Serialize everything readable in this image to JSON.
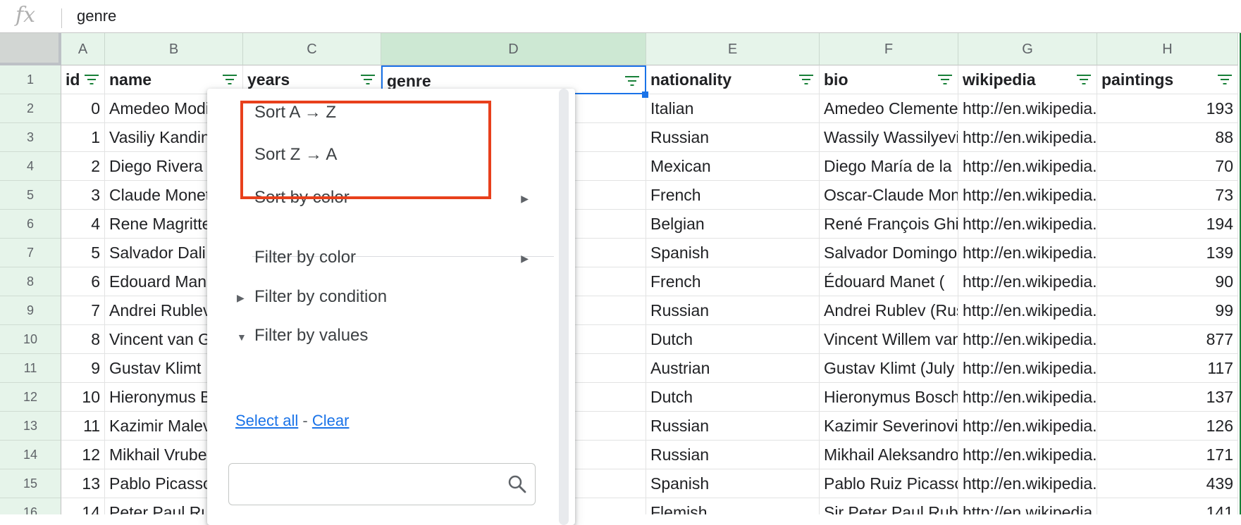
{
  "formula_bar": {
    "fx_label": "fx",
    "value": "genre"
  },
  "columns": [
    "A",
    "B",
    "C",
    "D",
    "E",
    "F",
    "G",
    "H"
  ],
  "header_row": [
    "id",
    "name",
    "years",
    "genre",
    "nationality",
    "bio",
    "wikipedia",
    "paintings"
  ],
  "rows": [
    {
      "n": "2",
      "id": "0",
      "name": "Amedeo Modigliani",
      "nationality": "Italian",
      "bio": "Amedeo Clemente Modigliani",
      "wikipedia": "http://en.wikipedia.org",
      "paintings": "193"
    },
    {
      "n": "3",
      "id": "1",
      "name": "Vasiliy Kandinskiy",
      "nationality": "Russian",
      "bio": "Wassily Wassilyevich",
      "wikipedia": "http://en.wikipedia.org",
      "paintings": "88"
    },
    {
      "n": "4",
      "id": "2",
      "name": "Diego Rivera",
      "nationality": "Mexican",
      "bio": "Diego María de la",
      "wikipedia": "http://en.wikipedia.org",
      "paintings": "70"
    },
    {
      "n": "5",
      "id": "3",
      "name": "Claude Monet",
      "nationality": "French",
      "bio": "Oscar-Claude Monet",
      "wikipedia": "http://en.wikipedia.org",
      "paintings": "73"
    },
    {
      "n": "6",
      "id": "4",
      "name": "Rene Magritte",
      "nationality": "Belgian",
      "bio": "René François Ghislain",
      "wikipedia": "http://en.wikipedia.org",
      "paintings": "194"
    },
    {
      "n": "7",
      "id": "5",
      "name": "Salvador Dali",
      "nationality": "Spanish",
      "bio": "Salvador Domingo",
      "wikipedia": "http://en.wikipedia.org",
      "paintings": "139"
    },
    {
      "n": "8",
      "id": "6",
      "name": "Edouard Manet",
      "nationality": "French",
      "bio": "Édouard Manet (",
      "wikipedia": "http://en.wikipedia.org",
      "paintings": "90"
    },
    {
      "n": "9",
      "id": "7",
      "name": "Andrei Rublev",
      "nationality": "Russian",
      "bio": "Andrei Rublev (Russian",
      "wikipedia": "http://en.wikipedia.org",
      "paintings": "99"
    },
    {
      "n": "10",
      "id": "8",
      "name": "Vincent van Gogh",
      "nationality": "Dutch",
      "bio": "Vincent Willem van",
      "wikipedia": "http://en.wikipedia.org",
      "paintings": "877"
    },
    {
      "n": "11",
      "id": "9",
      "name": "Gustav Klimt",
      "nationality": "Austrian",
      "bio": "Gustav Klimt (July",
      "wikipedia": "http://en.wikipedia.org",
      "paintings": "117"
    },
    {
      "n": "12",
      "id": "10",
      "name": "Hieronymus Bosch",
      "nationality": "Dutch",
      "bio": "Hieronymus Bosch",
      "wikipedia": "http://en.wikipedia.org",
      "paintings": "137"
    },
    {
      "n": "13",
      "id": "11",
      "name": "Kazimir Malevich",
      "nationality": "Russian",
      "bio": "Kazimir Severinovich",
      "wikipedia": "http://en.wikipedia.org",
      "paintings": "126"
    },
    {
      "n": "14",
      "id": "12",
      "name": "Mikhail Vrubel",
      "nationality": "Russian",
      "bio": "Mikhail Aleksandrovich",
      "wikipedia": "http://en.wikipedia.org",
      "paintings": "171"
    },
    {
      "n": "15",
      "id": "13",
      "name": "Pablo Picasso",
      "nationality": "Spanish",
      "bio": "Pablo Ruiz Picasso",
      "wikipedia": "http://en.wikipedia.org",
      "paintings": "439"
    },
    {
      "n": "16",
      "id": "14",
      "name": "Peter Paul Rubens",
      "nationality": "Flemish",
      "bio": "Sir Peter Paul Rubens",
      "wikipedia": "http://en.wikipedia.org",
      "paintings": "141"
    }
  ],
  "menu": {
    "sort_az": "Sort A → Z",
    "sort_za": "Sort Z → A",
    "sort_by_color": "Sort by color",
    "filter_by_color": "Filter by color",
    "filter_by_condition": "Filter by condition",
    "filter_by_values": "Filter by values",
    "select_all": "Select all",
    "separator": "-",
    "clear": "Clear",
    "search_placeholder": ""
  },
  "colors": {
    "header_green": "#e6f4ea",
    "filter_green": "#188038",
    "highlight": "#e8401c",
    "link": "#1a73e8"
  }
}
